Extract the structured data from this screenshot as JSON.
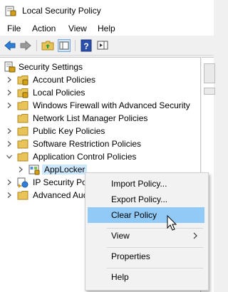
{
  "window": {
    "title": "Local Security Policy"
  },
  "menubar": {
    "items": [
      "File",
      "Action",
      "View",
      "Help"
    ]
  },
  "tree": {
    "root": "Security Settings",
    "items": [
      {
        "label": "Account Policies",
        "icon": "folder-lock-icon"
      },
      {
        "label": "Local Policies",
        "icon": "folder-lock-icon"
      },
      {
        "label": "Windows Firewall with Advanced Security",
        "icon": "folder-icon"
      },
      {
        "label": "Network List Manager Policies",
        "icon": "folder-icon"
      },
      {
        "label": "Public Key Policies",
        "icon": "folder-icon"
      },
      {
        "label": "Software Restriction Policies",
        "icon": "folder-icon"
      },
      {
        "label": "Application Control Policies",
        "icon": "folder-icon"
      },
      {
        "label": "AppLocker",
        "icon": "applocker-icon"
      },
      {
        "label": "IP Security Poli",
        "icon": "network-policy-icon"
      },
      {
        "label": "Advanced Audi",
        "icon": "folder-icon"
      }
    ]
  },
  "context_menu": {
    "items": [
      "Import Policy...",
      "Export Policy...",
      "Clear Policy",
      "View",
      "Properties",
      "Help"
    ],
    "highlighted": "Clear Policy"
  },
  "colors": {
    "selection": "#cce8ff",
    "menu_hover": "#91c9f7",
    "folder": "#e8c35a"
  }
}
